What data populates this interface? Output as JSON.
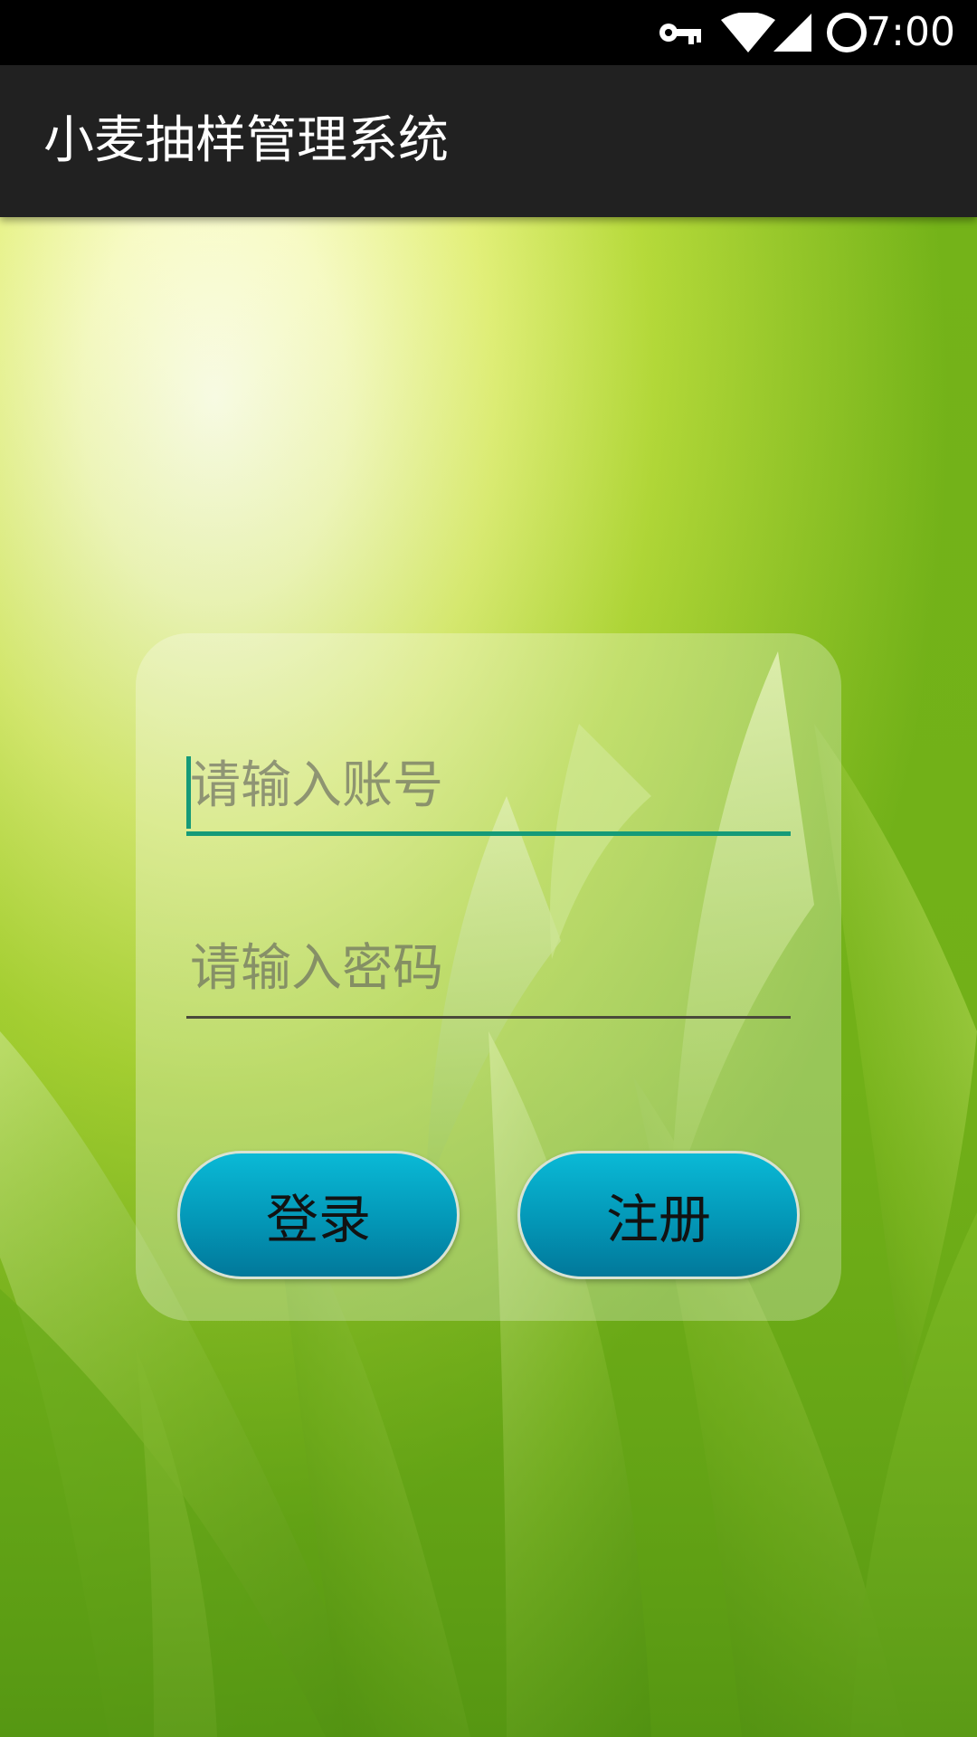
{
  "status_bar": {
    "time": "7:00",
    "icons": [
      "vpn-key-icon",
      "wifi-icon",
      "cell-signal-icon",
      "circle-icon"
    ]
  },
  "app_bar": {
    "title": "小麦抽样管理系统",
    "background_color": "#212121"
  },
  "background": {
    "description_icon": "grass-wallpaper"
  },
  "login_form": {
    "account_placeholder": "请输入账号",
    "account_value": "",
    "password_placeholder": "请输入密码",
    "password_value": "",
    "login_label": "登录",
    "register_label": "注册",
    "accent_color": "#159a78",
    "button_color": "#0397b7"
  }
}
